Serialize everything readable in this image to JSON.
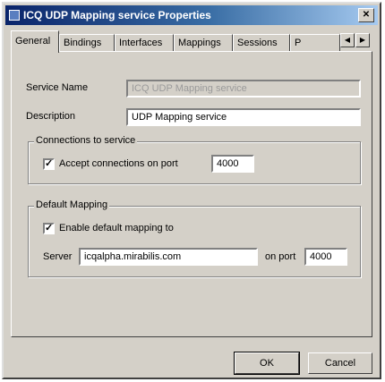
{
  "window": {
    "title": "ICQ UDP Mapping service Properties",
    "close_glyph": "✕"
  },
  "tabs": [
    {
      "label": "General",
      "active": true
    },
    {
      "label": "Bindings"
    },
    {
      "label": "Interfaces"
    },
    {
      "label": "Mappings"
    },
    {
      "label": "Sessions"
    },
    {
      "label": "P"
    }
  ],
  "tab_scroll": {
    "left": "◀",
    "right": "▶"
  },
  "form": {
    "service_name_label": "Service Name",
    "service_name_value": "ICQ UDP Mapping service",
    "description_label": "Description",
    "description_value": "UDP Mapping service"
  },
  "connections": {
    "group_title": "Connections to service",
    "accept_label": "Accept connections on port",
    "accept_checked": true,
    "port_value": "4000"
  },
  "default_mapping": {
    "group_title": "Default Mapping",
    "enable_label": "Enable default mapping to",
    "enable_checked": true,
    "server_label": "Server",
    "server_value": "icqalpha.mirabilis.com",
    "on_port_label": "on port",
    "port_value": "4000"
  },
  "buttons": {
    "ok": "OK",
    "cancel": "Cancel"
  },
  "check_glyph": "✓"
}
